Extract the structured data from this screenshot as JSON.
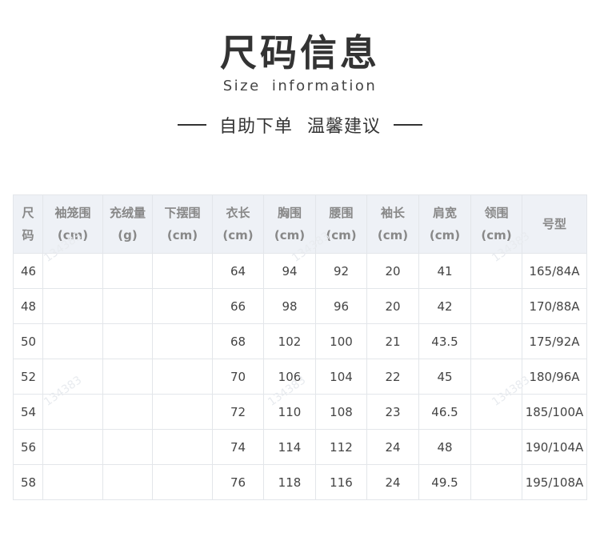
{
  "header": {
    "title_zh": "尺码信息",
    "title_en": "Size information",
    "slogan_part1": "自助下单",
    "slogan_part2": "温馨建议"
  },
  "table": {
    "headers": [
      [
        "尺",
        "码"
      ],
      [
        "袖笼围",
        "(cm)"
      ],
      [
        "充绒量",
        "(g)"
      ],
      [
        "下摆围",
        "(cm)"
      ],
      [
        "衣长",
        "(cm)"
      ],
      [
        "胸围",
        "(cm)"
      ],
      [
        "腰围",
        "(cm)"
      ],
      [
        "袖长",
        "(cm)"
      ],
      [
        "肩宽",
        "(cm)"
      ],
      [
        "领围",
        "(cm)"
      ],
      [
        "号型",
        ""
      ]
    ],
    "rows": [
      [
        "46",
        "",
        "",
        "",
        "64",
        "94",
        "92",
        "20",
        "41",
        "",
        "165/84A"
      ],
      [
        "48",
        "",
        "",
        "",
        "66",
        "98",
        "96",
        "20",
        "42",
        "",
        "170/88A"
      ],
      [
        "50",
        "",
        "",
        "",
        "68",
        "102",
        "100",
        "21",
        "43.5",
        "",
        "175/92A"
      ],
      [
        "52",
        "",
        "",
        "",
        "70",
        "106",
        "104",
        "22",
        "45",
        "",
        "180/96A"
      ],
      [
        "54",
        "",
        "",
        "",
        "72",
        "110",
        "108",
        "23",
        "46.5",
        "",
        "185/100A"
      ],
      [
        "56",
        "",
        "",
        "",
        "74",
        "114",
        "112",
        "24",
        "48",
        "",
        "190/104A"
      ],
      [
        "58",
        "",
        "",
        "",
        "76",
        "118",
        "116",
        "24",
        "49.5",
        "",
        "195/108A"
      ]
    ]
  },
  "watermark": "134383"
}
